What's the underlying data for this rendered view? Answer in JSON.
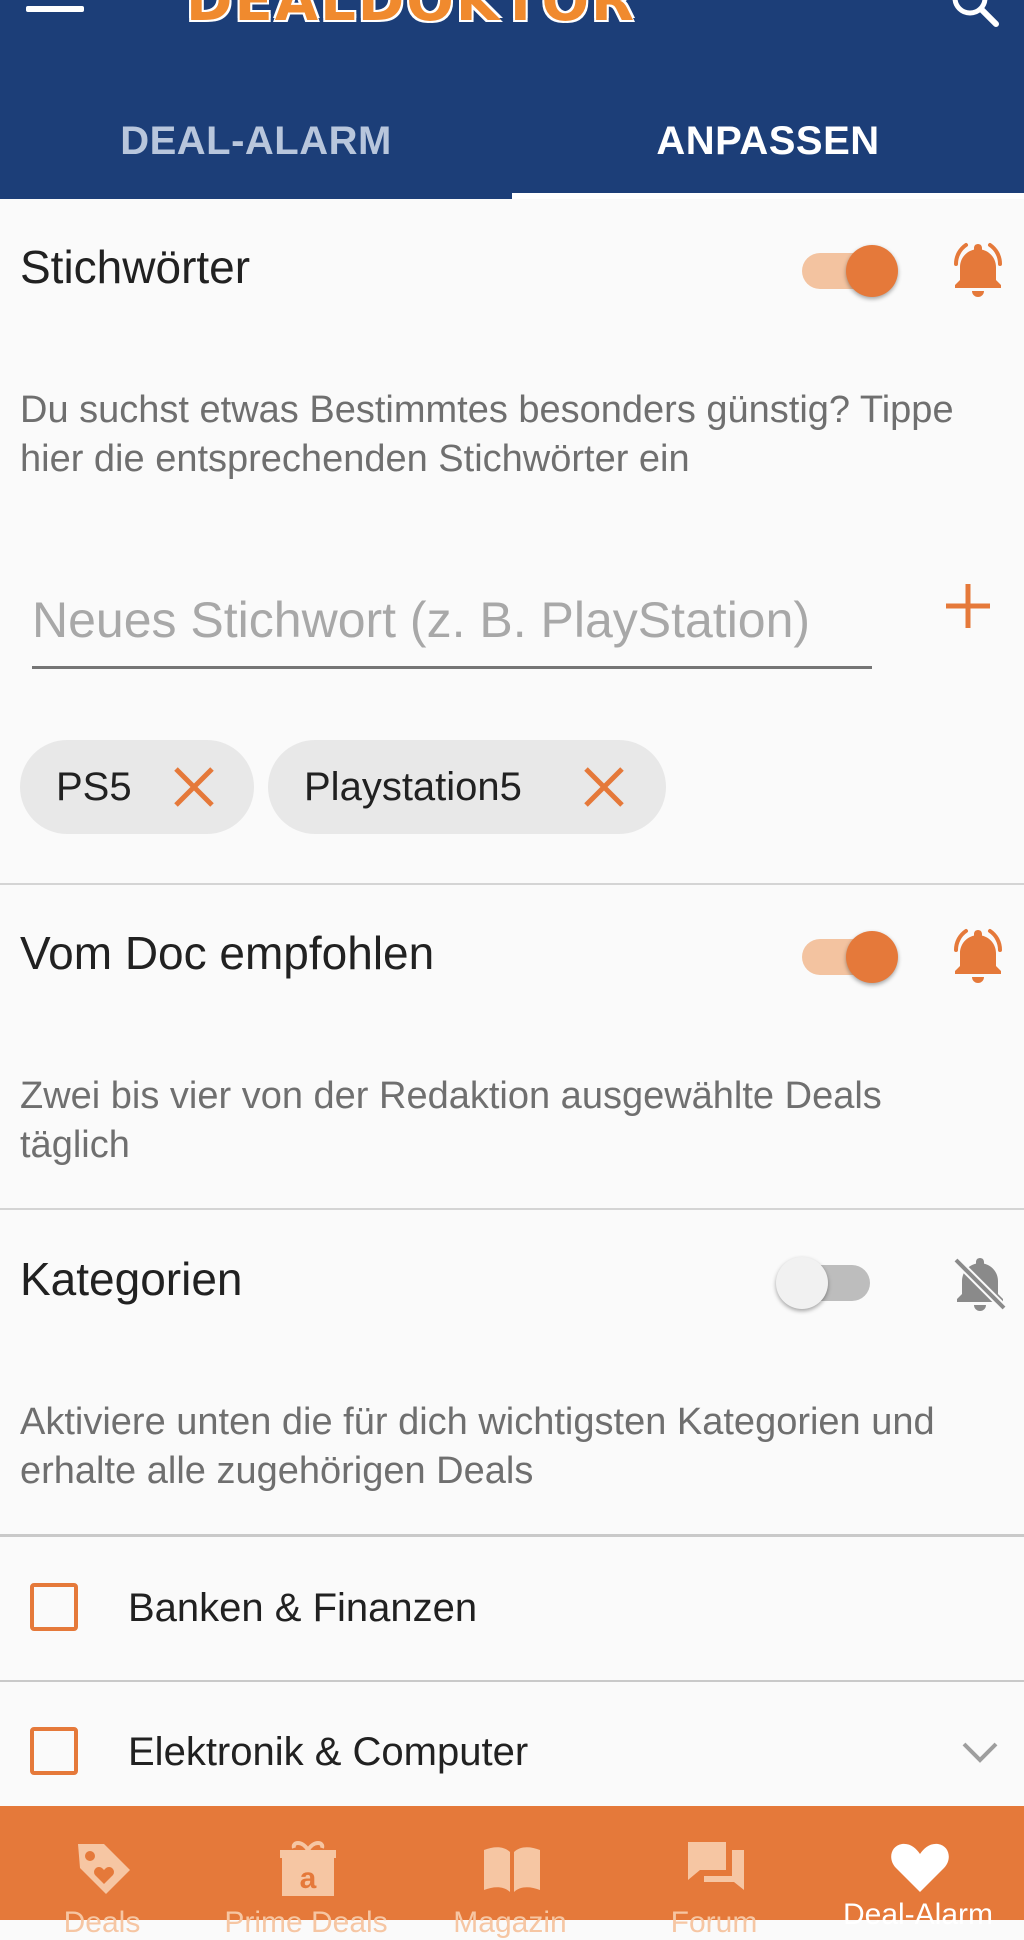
{
  "header": {
    "logo_text": "DEALDOKTOR",
    "tabs": [
      {
        "label": "DEAL-ALARM",
        "active": false
      },
      {
        "label": "ANPASSEN",
        "active": true
      }
    ]
  },
  "keywords": {
    "title": "Stichwörter",
    "enabled": true,
    "description": "Du suchst etwas Bestimmtes besonders günstig? Tippe hier die entsprechenden Stichwörter ein",
    "input_value": "",
    "input_placeholder": "Neues Stichwort (z. B. PlayStation)",
    "chips": [
      {
        "label": "PS5"
      },
      {
        "label": "Playstation5"
      }
    ]
  },
  "doc": {
    "title": "Vom Doc empfohlen",
    "enabled": true,
    "description": "Zwei bis vier von der Redaktion ausgewählte Deals täglich"
  },
  "categories": {
    "title": "Kategorien",
    "enabled": false,
    "description": "Aktiviere unten die für dich wichtigsten Kategorien und erhalte alle zugehörigen Deals",
    "items": [
      {
        "label": "Banken & Finanzen",
        "checked": false
      },
      {
        "label": "Elektronik & Computer",
        "checked": false
      }
    ]
  },
  "bottom_nav": [
    {
      "label": "Deals",
      "icon": "tag-heart-icon",
      "active": false
    },
    {
      "label": "Prime Deals",
      "icon": "amazon-gift-icon",
      "active": false
    },
    {
      "label": "Magazin",
      "icon": "book-icon",
      "active": false
    },
    {
      "label": "Forum",
      "icon": "chat-icon",
      "active": false
    },
    {
      "label": "Deal-Alarm",
      "icon": "heart-icon",
      "active": true
    }
  ],
  "colors": {
    "header_bg": "#1c3e78",
    "accent": "#e5793a",
    "background": "#fafafa"
  }
}
